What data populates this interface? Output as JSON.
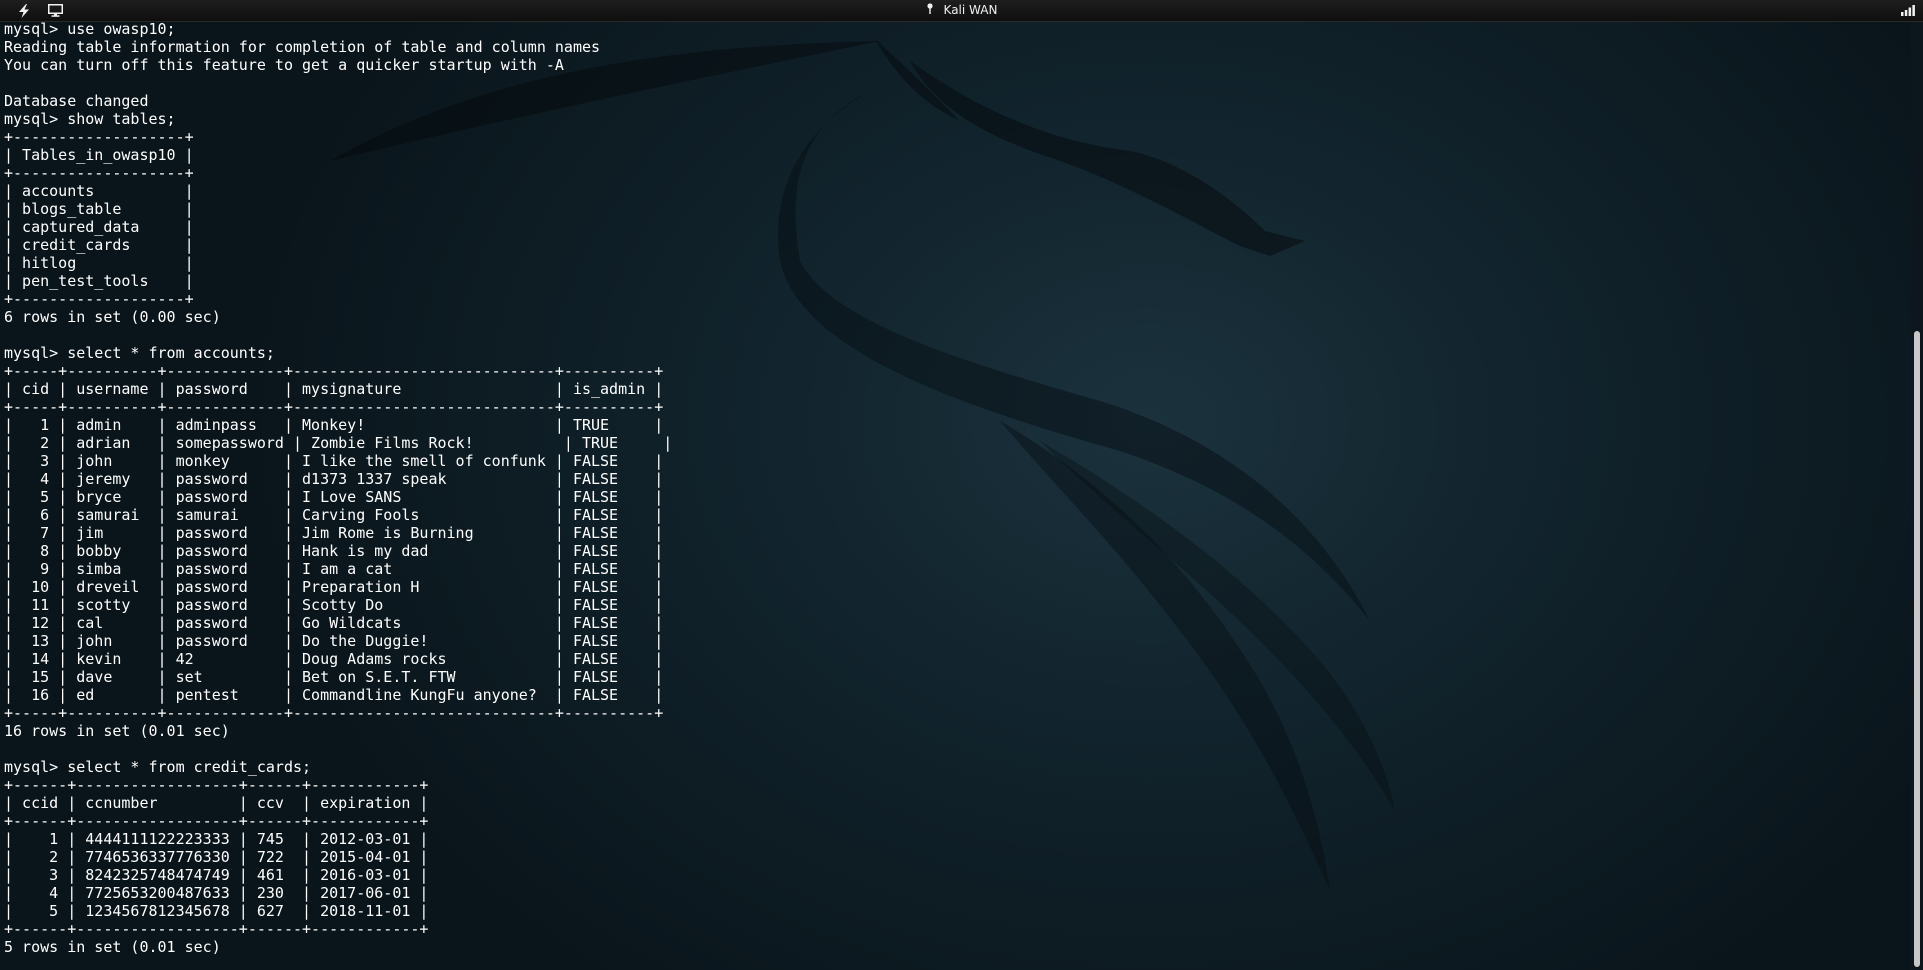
{
  "topbar": {
    "title": "Kali WAN",
    "icons": [
      "lightning-icon",
      "monitor-icon",
      "pin-icon",
      "signal-icon"
    ]
  },
  "colors": {
    "terminal_text": "#ffffff",
    "desktop_bg": "#11232c",
    "topbar_bg": "#141414"
  },
  "terminal": {
    "lines": [
      "mysql> use owasp10;",
      "Reading table information for completion of table and column names",
      "You can turn off this feature to get a quicker startup with -A",
      "",
      "Database changed",
      "mysql> show tables;",
      "+-------------------+",
      "| Tables_in_owasp10 |",
      "+-------------------+",
      "| accounts          |",
      "| blogs_table       |",
      "| captured_data     |",
      "| credit_cards      |",
      "| hitlog            |",
      "| pen_test_tools    |",
      "+-------------------+",
      "6 rows in set (0.00 sec)",
      "",
      "mysql> select * from accounts;",
      "+-----+----------+-------------+-----------------------------+----------+",
      "| cid | username | password    | mysignature                 | is_admin |",
      "+-----+----------+-------------+-----------------------------+----------+",
      "|   1 | admin    | adminpass   | Monkey!                     | TRUE     |",
      "|   2 | adrian   | somepassword | Zombie Films Rock!          | TRUE     |",
      "|   3 | john     | monkey      | I like the smell of confunk | FALSE    |",
      "|   4 | jeremy   | password    | d1373 1337 speak            | FALSE    |",
      "|   5 | bryce    | password    | I Love SANS                 | FALSE    |",
      "|   6 | samurai  | samurai     | Carving Fools               | FALSE    |",
      "|   7 | jim      | password    | Jim Rome is Burning         | FALSE    |",
      "|   8 | bobby    | password    | Hank is my dad              | FALSE    |",
      "|   9 | simba    | password    | I am a cat                  | FALSE    |",
      "|  10 | dreveil  | password    | Preparation H               | FALSE    |",
      "|  11 | scotty   | password    | Scotty Do                   | FALSE    |",
      "|  12 | cal      | password    | Go Wildcats                 | FALSE    |",
      "|  13 | john     | password    | Do the Duggie!              | FALSE    |",
      "|  14 | kevin    | 42          | Doug Adams rocks            | FALSE    |",
      "|  15 | dave     | set         | Bet on S.E.T. FTW           | FALSE    |",
      "|  16 | ed       | pentest     | Commandline KungFu anyone?  | FALSE    |",
      "+-----+----------+-------------+-----------------------------+----------+",
      "16 rows in set (0.01 sec)",
      "",
      "mysql> select * from credit_cards;",
      "+------+------------------+------+------------+",
      "| ccid | ccnumber         | ccv  | expiration |",
      "+------+------------------+------+------------+",
      "|    1 | 4444111122223333 | 745  | 2012-03-01 |",
      "|    2 | 7746536337776330 | 722  | 2015-04-01 |",
      "|    3 | 8242325748474749 | 461  | 2016-03-01 |",
      "|    4 | 7725653200487633 | 230  | 2017-06-01 |",
      "|    5 | 1234567812345678 | 627  | 2018-11-01 |",
      "+------+------------------+------+------------+",
      "5 rows in set (0.01 sec)"
    ]
  }
}
